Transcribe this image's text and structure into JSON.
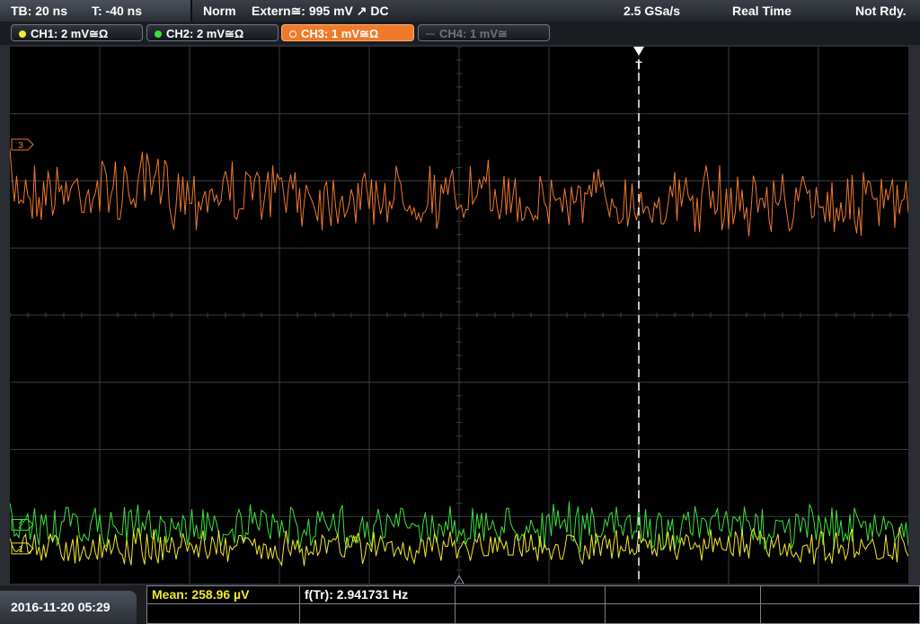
{
  "status": {
    "timebase": "TB: 20 ns",
    "trigger_time": "T: -40 ns",
    "trigger_mode": "Norm",
    "trigger_source": "Extern≅: 995 mV ↗ DC",
    "sample_rate": "2.5 GSa/s",
    "acq_mode": "Real Time",
    "state": "Not Rdy."
  },
  "channels": [
    {
      "label": "CH1: 2 mV≅Ω",
      "color": "#f2ea28",
      "active": false,
      "enabled": true
    },
    {
      "label": "CH2: 2 mV≅Ω",
      "color": "#3ce23c",
      "active": false,
      "enabled": true
    },
    {
      "label": "CH3: 1 mV≅Ω",
      "color": "#f07a2a",
      "active": true,
      "enabled": true
    },
    {
      "label": "CH4: 1 mV≅",
      "color": "#6f737a",
      "active": false,
      "enabled": false
    }
  ],
  "markers": {
    "ch1": "1",
    "ch2": "2",
    "ch3": "3",
    "trigger": "T"
  },
  "colors": {
    "ch1": "#f2ea28",
    "ch2": "#3ce23c",
    "ch3": "#f07a2a",
    "grid": "#3a3d42"
  },
  "footer": {
    "datetime": "2016-11-20 05:29",
    "mean_label": "Mean: 258.96 µV",
    "freq_label": "f(Tr): 2.941731 Hz"
  },
  "chart_data": {
    "type": "line",
    "divisions": {
      "x": 10,
      "y": 8
    },
    "trigger_position_div": 7,
    "series": [
      {
        "name": "CH3",
        "color": "#f07a2a",
        "level_div": 2.1,
        "amplitude_div": 0.55
      },
      {
        "name": "CH2",
        "color": "#3ce23c",
        "level_div": 7.15,
        "amplitude_div": 0.35
      },
      {
        "name": "CH1",
        "color": "#f2ea28",
        "level_div": 7.45,
        "amplitude_div": 0.28
      }
    ]
  }
}
